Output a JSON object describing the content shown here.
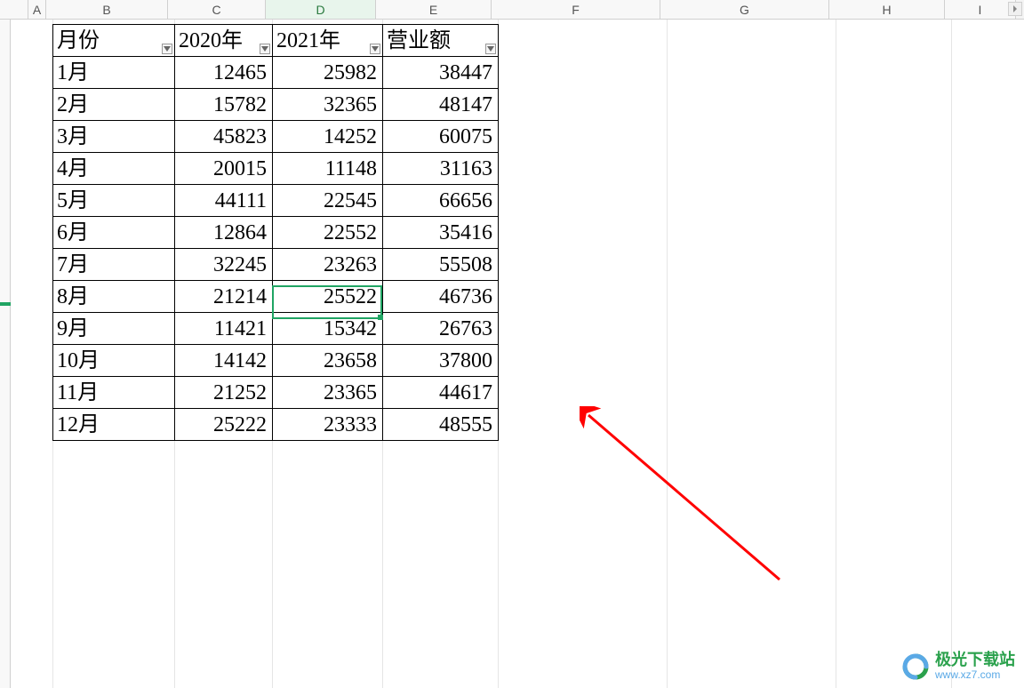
{
  "columns": {
    "A": "A",
    "B": "B",
    "C": "C",
    "D": "D",
    "E": "E",
    "F": "F",
    "G": "G",
    "H": "H",
    "I": "I"
  },
  "headers": {
    "month": "月份",
    "y2020": "2020年",
    "y2021": "2021年",
    "revenue": "营业额"
  },
  "rows": [
    {
      "month": "1月",
      "y2020": "12465",
      "y2021": "25982",
      "revenue": "38447"
    },
    {
      "month": "2月",
      "y2020": "15782",
      "y2021": "32365",
      "revenue": "48147"
    },
    {
      "month": "3月",
      "y2020": "45823",
      "y2021": "14252",
      "revenue": "60075"
    },
    {
      "month": "4月",
      "y2020": "20015",
      "y2021": "11148",
      "revenue": "31163"
    },
    {
      "month": "5月",
      "y2020": "44111",
      "y2021": "22545",
      "revenue": "66656"
    },
    {
      "month": "6月",
      "y2020": "12864",
      "y2021": "22552",
      "revenue": "35416"
    },
    {
      "month": "7月",
      "y2020": "32245",
      "y2021": "23263",
      "revenue": "55508"
    },
    {
      "month": "8月",
      "y2020": "21214",
      "y2021": "25522",
      "revenue": "46736"
    },
    {
      "month": "9月",
      "y2020": "11421",
      "y2021": "15342",
      "revenue": "26763"
    },
    {
      "month": "10月",
      "y2020": "14142",
      "y2021": "23658",
      "revenue": "37800"
    },
    {
      "month": "11月",
      "y2020": "21252",
      "y2021": "23365",
      "revenue": "44617"
    },
    {
      "month": "12月",
      "y2020": "25222",
      "y2021": "23333",
      "revenue": "48555"
    }
  ],
  "active_cell": {
    "ref": "D9",
    "value": "25522"
  },
  "watermark": {
    "title": "极光下载站",
    "url": "www.xz7.com"
  },
  "chart_data": {
    "type": "table",
    "title": "",
    "columns": [
      "月份",
      "2020年",
      "2021年",
      "营业额"
    ],
    "categories": [
      "1月",
      "2月",
      "3月",
      "4月",
      "5月",
      "6月",
      "7月",
      "8月",
      "9月",
      "10月",
      "11月",
      "12月"
    ],
    "series": [
      {
        "name": "2020年",
        "values": [
          12465,
          15782,
          45823,
          20015,
          44111,
          12864,
          32245,
          21214,
          11421,
          14142,
          21252,
          25222
        ]
      },
      {
        "name": "2021年",
        "values": [
          25982,
          32365,
          14252,
          11148,
          22545,
          22552,
          23263,
          25522,
          15342,
          23658,
          23365,
          23333
        ]
      },
      {
        "name": "营业额",
        "values": [
          38447,
          48147,
          60075,
          31163,
          66656,
          35416,
          55508,
          46736,
          26763,
          37800,
          44617,
          48555
        ]
      }
    ]
  }
}
